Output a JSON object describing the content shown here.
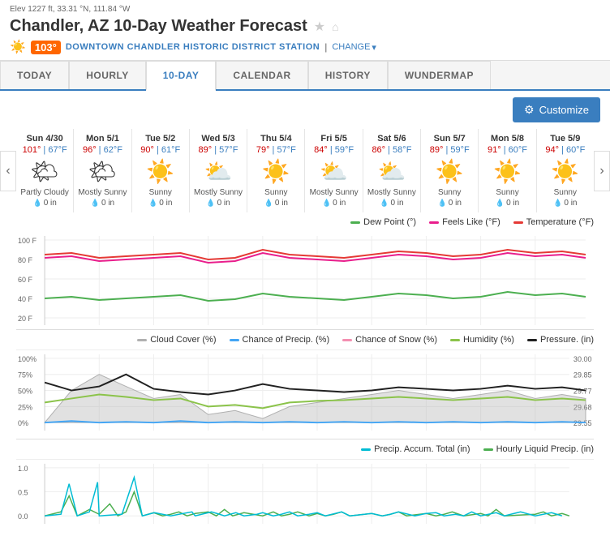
{
  "elev": "Elev 1227 ft, 33.31 °N, 111.84 °W",
  "title": "Chandler, AZ 10-Day Weather Forecast",
  "temp_badge": "103°",
  "station": "DOWNTOWN CHANDLER HISTORIC DISTRICT STATION",
  "separator": "|",
  "change_label": "CHANGE",
  "tabs": [
    {
      "label": "TODAY",
      "active": false
    },
    {
      "label": "HOURLY",
      "active": false
    },
    {
      "label": "10-DAY",
      "active": true
    },
    {
      "label": "CALENDAR",
      "active": false
    },
    {
      "label": "HISTORY",
      "active": false
    },
    {
      "label": "WUNDERMAP",
      "active": false
    }
  ],
  "customize_label": "Customize",
  "days": [
    {
      "date": "Sun 4/30",
      "high": "101°",
      "low": "67°F",
      "icon": "🌤",
      "desc": "Partly Cloudy",
      "precip": "0 in"
    },
    {
      "date": "Mon 5/1",
      "high": "96°",
      "low": "62°F",
      "icon": "🌤",
      "desc": "Mostly Sunny",
      "precip": "0 in"
    },
    {
      "date": "Tue 5/2",
      "high": "90°",
      "low": "61°F",
      "icon": "☀️",
      "desc": "Sunny",
      "precip": "0 in"
    },
    {
      "date": "Wed 5/3",
      "high": "89°",
      "low": "57°F",
      "icon": "⛅",
      "desc": "Mostly Sunny",
      "precip": "0 in"
    },
    {
      "date": "Thu 5/4",
      "high": "79°",
      "low": "57°F",
      "icon": "☀️",
      "desc": "Sunny",
      "precip": "0 in"
    },
    {
      "date": "Fri 5/5",
      "high": "84°",
      "low": "59°F",
      "icon": "⛅",
      "desc": "Mostly Sunny",
      "precip": "0 in"
    },
    {
      "date": "Sat 5/6",
      "high": "86°",
      "low": "58°F",
      "icon": "⛅",
      "desc": "Mostly Sunny",
      "precip": "0 in"
    },
    {
      "date": "Sun 5/7",
      "high": "89°",
      "low": "59°F",
      "icon": "☀️",
      "desc": "Sunny",
      "precip": "0 in"
    },
    {
      "date": "Mon 5/8",
      "high": "91°",
      "low": "60°F",
      "icon": "☀️",
      "desc": "Sunny",
      "precip": "0 in"
    },
    {
      "date": "Tue 5/9",
      "high": "94°",
      "low": "60°F",
      "icon": "☀️",
      "desc": "Sunny",
      "precip": "0 in"
    }
  ],
  "chart1_legend": [
    {
      "color": "#4caf50",
      "label": "Dew Point (°)"
    },
    {
      "color": "#e91e8c",
      "label": "Feels Like (°F)"
    },
    {
      "color": "#e53935",
      "label": "Temperature (°F)"
    }
  ],
  "chart2_legend": [
    {
      "color": "#b0b0b0",
      "label": "Cloud Cover (%)"
    },
    {
      "color": "#42a5f5",
      "label": "Chance of Precip. (%)"
    },
    {
      "color": "#f48fb1",
      "label": "Chance of Snow (%)"
    },
    {
      "color": "#8bc34a",
      "label": "Humidity (%)"
    },
    {
      "color": "#212121",
      "label": "Pressure. (in)"
    }
  ],
  "chart3_legend": [
    {
      "color": "#00bcd4",
      "label": "Precip. Accum. Total (in)"
    },
    {
      "color": "#4caf50",
      "label": "Hourly Liquid Precip. (in)"
    }
  ],
  "y_labels_chart1": [
    "100 F",
    "80 F",
    "60 F",
    "40 F",
    "20 F"
  ],
  "y_labels_chart2": [
    "100%",
    "75%",
    "50%",
    "25%",
    "0%"
  ],
  "y_labels_chart2_r": [
    "30.00",
    "29.85",
    "29.77",
    "29.68",
    "29.55"
  ],
  "y_labels_chart3": [
    "1.0",
    "0.5",
    "0.0"
  ]
}
